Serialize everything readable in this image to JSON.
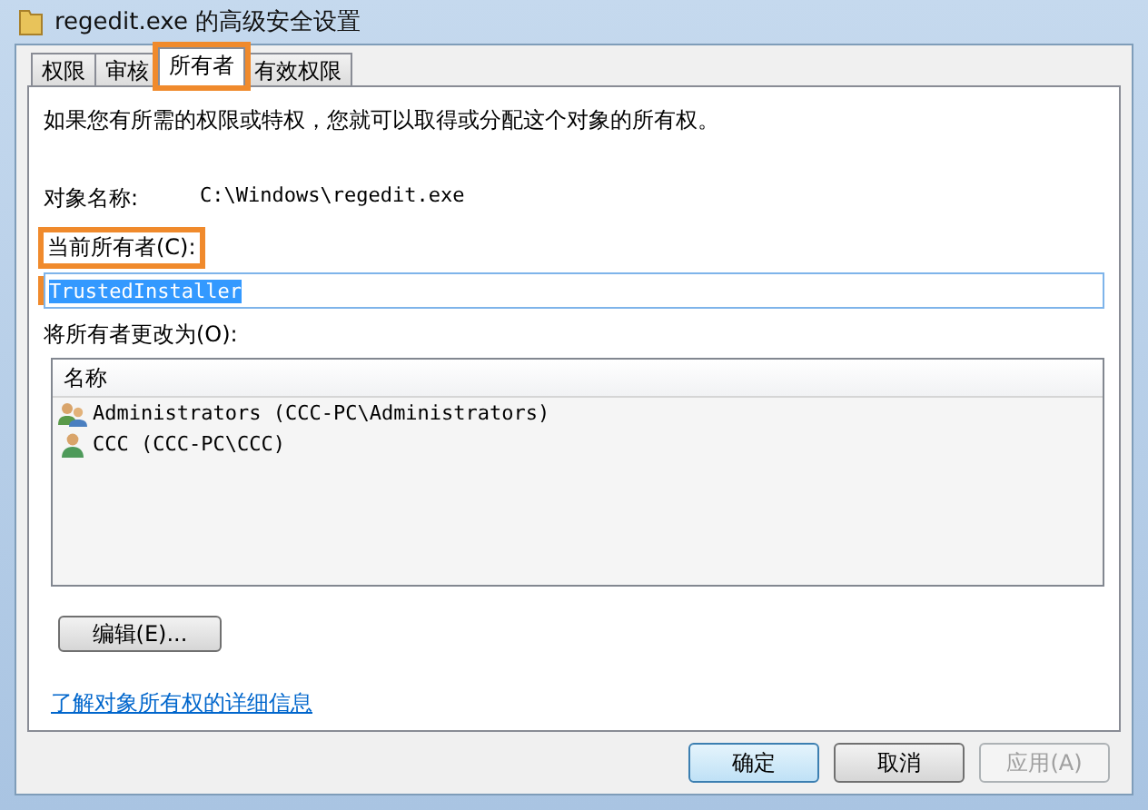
{
  "window": {
    "title": "regedit.exe 的高级安全设置"
  },
  "tabs": [
    {
      "label": "权限",
      "selected": false,
      "highlighted": false
    },
    {
      "label": "审核",
      "selected": false,
      "highlighted": false
    },
    {
      "label": "所有者",
      "selected": true,
      "highlighted": true
    },
    {
      "label": "有效权限",
      "selected": false,
      "highlighted": false
    }
  ],
  "intro": "如果您有所需的权限或特权，您就可以取得或分配这个对象的所有权。",
  "object_name": {
    "label": "对象名称:",
    "value": "C:\\Windows\\regedit.exe"
  },
  "current_owner": {
    "label": "当前所有者(C):",
    "value": "TrustedInstaller",
    "highlighted": true,
    "value_selected": true
  },
  "change_owner": {
    "label": "将所有者更改为(O):",
    "column": "名称",
    "rows": [
      {
        "kind": "group",
        "name": "Administrators (CCC-PC\\Administrators)"
      },
      {
        "kind": "user",
        "name": "CCC (CCC-PC\\CCC)"
      }
    ]
  },
  "edit_button": "编辑(E)...",
  "link": "了解对象所有权的详细信息",
  "buttons": [
    {
      "label": "确定",
      "default": true,
      "disabled": false
    },
    {
      "label": "取消",
      "default": false,
      "disabled": false
    },
    {
      "label": "应用(A)",
      "default": false,
      "disabled": true
    }
  ]
}
